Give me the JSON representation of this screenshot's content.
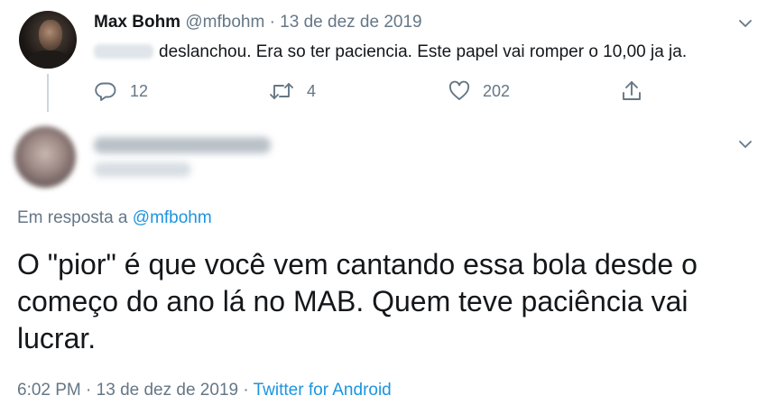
{
  "parent_tweet": {
    "author_name": "Max Bohm",
    "author_handle": "@mfbohm",
    "separator": "·",
    "date": "13 de dez de 2019",
    "text": "deslanchou. Era so ter paciencia. Este papel vai romper o 10,00 ja ja.",
    "actions": {
      "reply_count": "12",
      "retweet_count": "4",
      "like_count": "202"
    },
    "icons": [
      "reply-icon",
      "retweet-icon",
      "like-icon",
      "share-icon",
      "chevron-down-icon"
    ]
  },
  "focused_tweet": {
    "reply_prefix": "Em resposta a",
    "reply_handle": "@mfbohm",
    "text": "O \"pior\" é que você vem cantando essa bola desde o começo do ano lá no MAB. Quem teve paciência vai lucrar.",
    "time": "6:02 PM",
    "separator1": "·",
    "date": "13 de dez de 2019",
    "separator2": "·",
    "source": "Twitter for Android"
  },
  "colors": {
    "text": "#14171a",
    "muted": "#657786",
    "link": "#1b95e0",
    "thread_line": "#ccd6dd"
  }
}
